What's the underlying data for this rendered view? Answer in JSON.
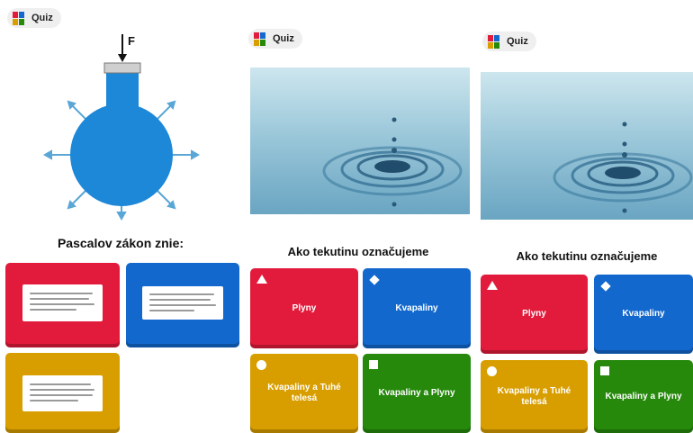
{
  "brand": {
    "quiz_label": "Quiz",
    "logo_colors": [
      "#e21b3c",
      "#1368ce",
      "#d89e00",
      "#26890c"
    ]
  },
  "panel1": {
    "diagram": {
      "force_label": "F",
      "water_color": "#1e88d8",
      "arrow_color": "#5aa6d6"
    },
    "question": "Pascalov zákon znie:",
    "answers": [
      {
        "color": "red",
        "has_text_card": true
      },
      {
        "color": "blue",
        "has_text_card": true
      },
      {
        "color": "yellow",
        "has_text_card": true
      }
    ]
  },
  "panel2": {
    "question": "Ako tekutinu označujeme",
    "answers": [
      {
        "label": "Plyny",
        "color": "red",
        "shape": "triangle"
      },
      {
        "label": "Kvapaliny",
        "color": "blue",
        "shape": "diamond"
      },
      {
        "label": "Kvapaliny a Tuhé telesá",
        "color": "yellow",
        "shape": "circle"
      },
      {
        "label": "Kvapaliny a Plyny",
        "color": "green",
        "shape": "square"
      }
    ]
  },
  "panel3": {
    "question": "Ako tekutinu označujeme",
    "answers": [
      {
        "label": "Plyny",
        "color": "red",
        "shape": "triangle"
      },
      {
        "label": "Kvapaliny",
        "color": "blue",
        "shape": "diamond"
      },
      {
        "label": "Kvapaliny a Tuhé telesá",
        "color": "yellow",
        "shape": "circle"
      },
      {
        "label": "Kvapaliny a Plyny",
        "color": "green",
        "shape": "square"
      }
    ]
  }
}
